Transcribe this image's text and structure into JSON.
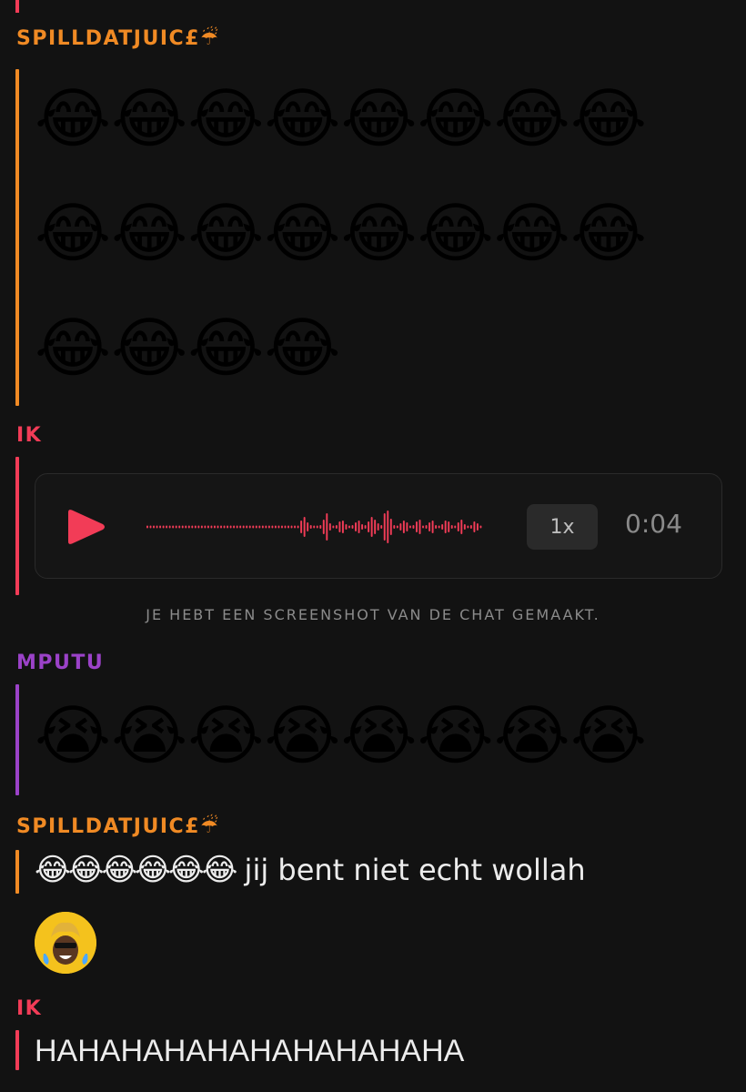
{
  "colors": {
    "background": "#121212",
    "spilldatjuice": "#f08a24",
    "ik": "#f23c57",
    "mputu": "#9b42c8"
  },
  "messages": [
    {
      "sender": "SPILLDATJUIC£☔",
      "type": "emoji",
      "rows": [
        "😂😂😂😂😂😂😂😂",
        "😂😂😂😂😂😂😂😂",
        "😂😂😂😂"
      ]
    },
    {
      "sender": "IK",
      "type": "voice-note",
      "speed": "1x",
      "duration": "0:04"
    },
    {
      "type": "system",
      "text": "JE HEBT EEN SCREENSHOT VAN DE CHAT GEMAAKT."
    },
    {
      "sender": "MPUTU",
      "type": "emoji",
      "rows": [
        "😭😭😭😭😭😭😭😭"
      ]
    },
    {
      "sender": "SPILLDATJUIC£☔",
      "type": "text",
      "emojis": "😂😂😂😂😂😂",
      "text": "jij bent niet echt wollah"
    },
    {
      "type": "bitmoji-reaction",
      "icon": "bitmoji-laughing-icon"
    },
    {
      "sender": "IK",
      "type": "text",
      "text": "HAHAHAHAHAHAHAHAHAHA"
    }
  ]
}
